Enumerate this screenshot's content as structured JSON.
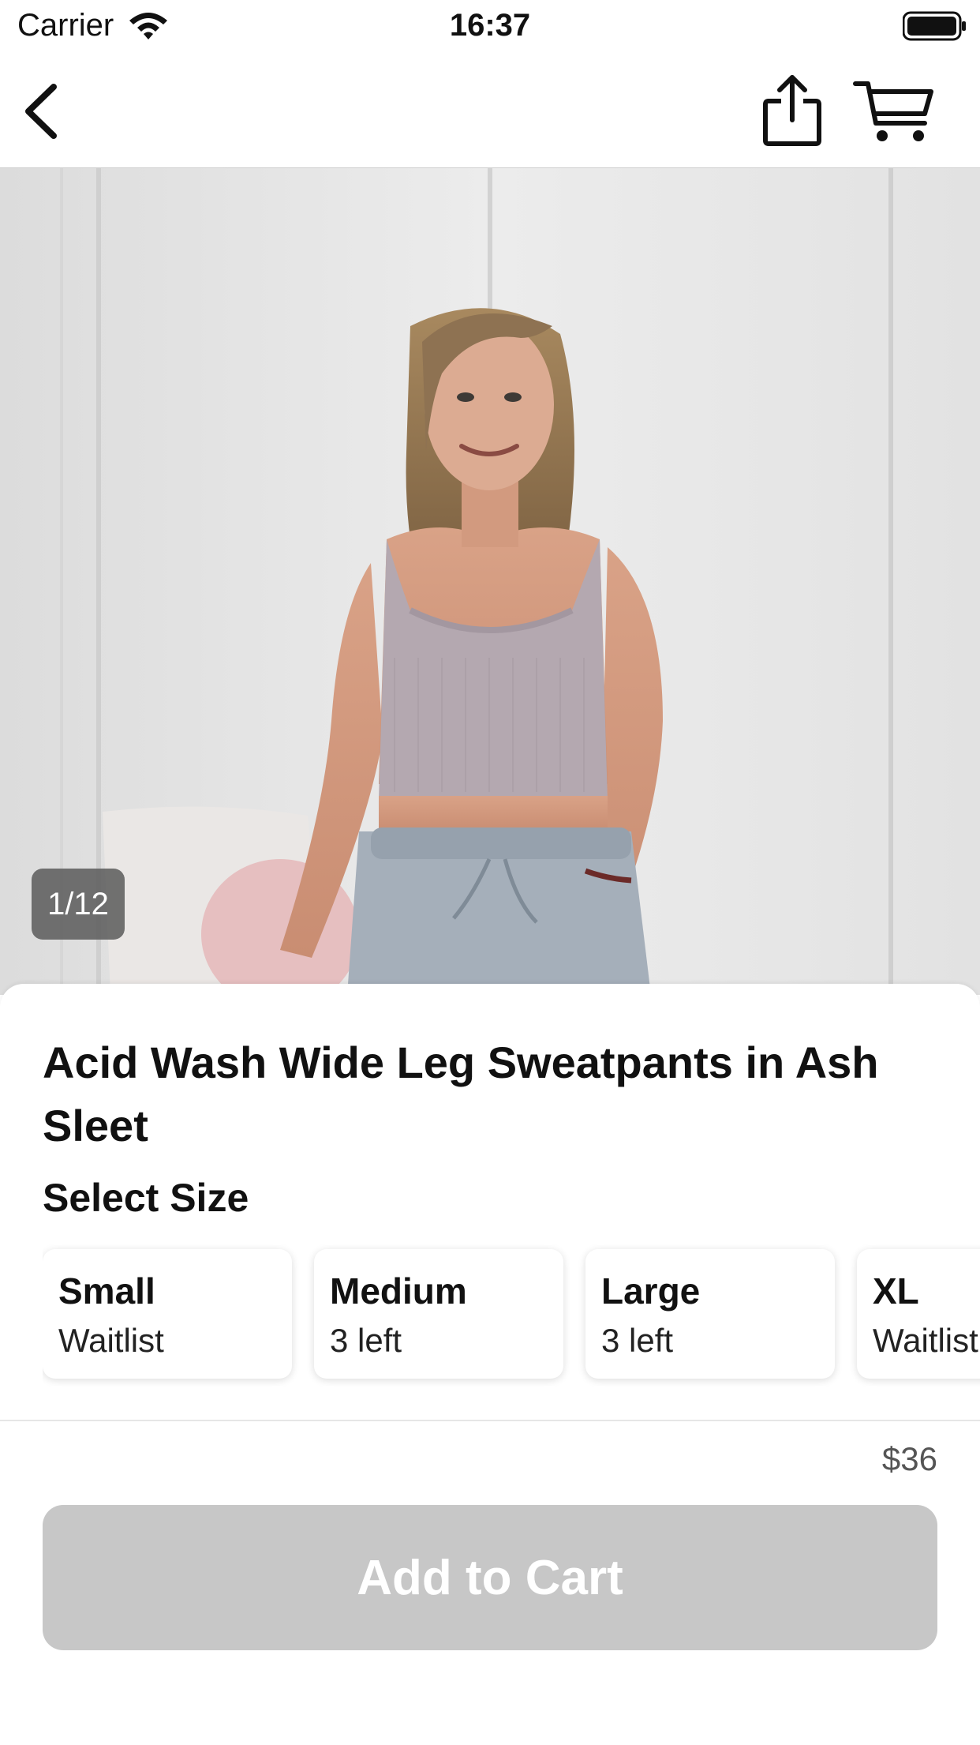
{
  "status_bar": {
    "carrier": "Carrier",
    "time": "16:37"
  },
  "nav": {
    "back_icon": "chevron-left-icon",
    "share_icon": "share-icon",
    "cart_icon": "cart-icon"
  },
  "gallery": {
    "counter": "1/12"
  },
  "product": {
    "title": "Acid Wash Wide Leg Sweatpants in Ash Sleet",
    "size_heading": "Select Size",
    "sizes": [
      {
        "name": "Small",
        "status": "Waitlist"
      },
      {
        "name": "Medium",
        "status": "3 left"
      },
      {
        "name": "Large",
        "status": "3 left"
      },
      {
        "name": "XL",
        "status": "Waitlist"
      }
    ],
    "price": "$36"
  },
  "footer": {
    "add_to_cart_label": "Add to Cart"
  },
  "colors": {
    "button_disabled": "#c7c7c7",
    "counter_bg": "#5a5a5a"
  }
}
